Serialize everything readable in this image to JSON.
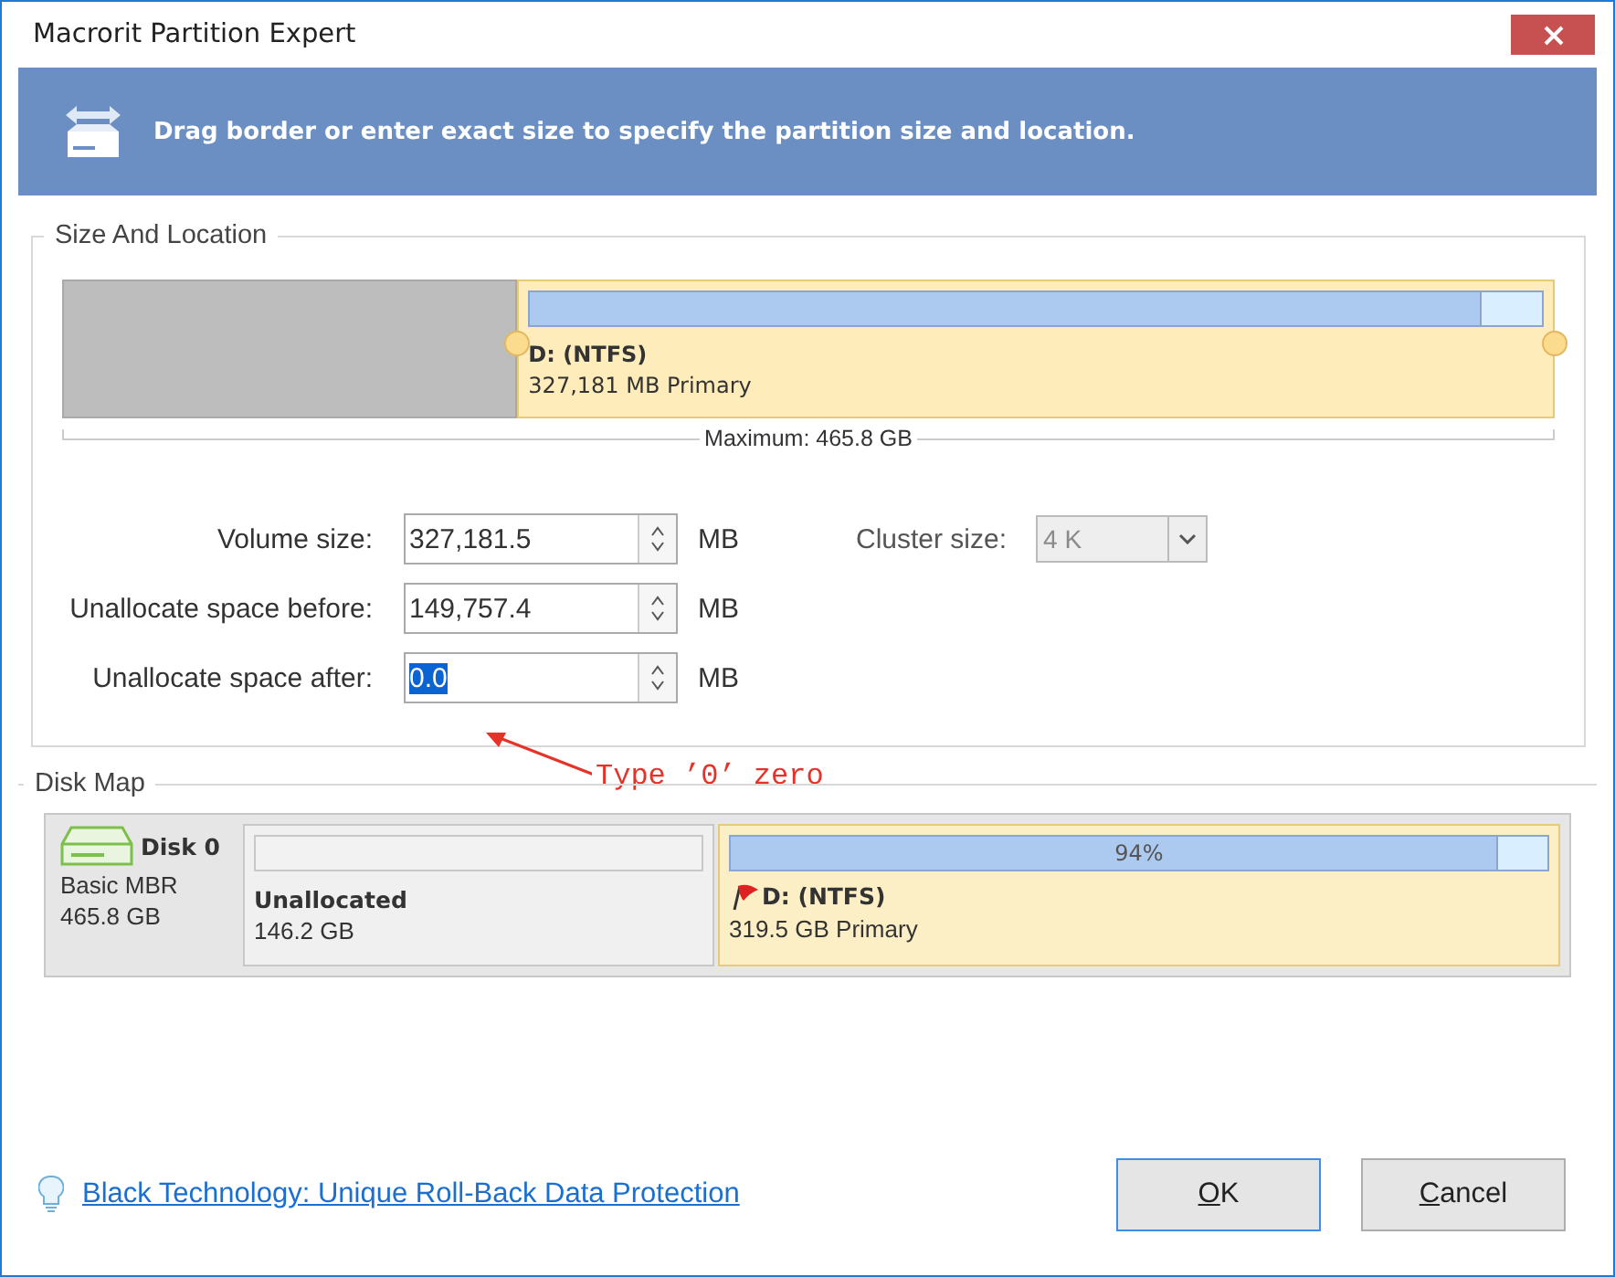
{
  "window": {
    "title": "Macrorit Partition Expert"
  },
  "banner": {
    "text": "Drag border or enter exact size to specify the partition size and location."
  },
  "size_and_location": {
    "title": "Size And Location",
    "unallocated_before": {
      "level": 0.305
    },
    "partition": {
      "name": "D: (NTFS)",
      "detail": "327,181 MB Primary",
      "level": 0.94
    },
    "maximum": "Maximum: 465.8 GB",
    "fields": [
      {
        "label": "Volume size:",
        "value": "327,181.5",
        "unit": "MB",
        "selected": false
      },
      {
        "label": "Unallocate space before:",
        "value": "149,757.4",
        "unit": "MB",
        "selected": false
      },
      {
        "label": "Unallocate space after:",
        "value": "0.0",
        "unit": "MB",
        "selected": true
      }
    ],
    "cluster": {
      "label": "Cluster size:",
      "value": "4 K",
      "disabled": true
    },
    "annotation": "Type ’0’ zero"
  },
  "disk_map": {
    "title": "Disk Map",
    "disk": {
      "name": "Disk 0",
      "type": "Basic MBR",
      "size": "465.8 GB"
    },
    "partitions": [
      {
        "kind": "unallocated",
        "name": "Unallocated",
        "detail": "146.2 GB"
      },
      {
        "kind": "primary",
        "name": "D: (NTFS)",
        "detail": "319.5 GB Primary",
        "usage": "94%",
        "level": 0.94
      }
    ]
  },
  "footer": {
    "link": "Black Technology: Unique Roll-Back Data Protection",
    "buttons": [
      {
        "label": "OK",
        "default": true
      },
      {
        "label": "Cancel",
        "default": false
      }
    ]
  }
}
